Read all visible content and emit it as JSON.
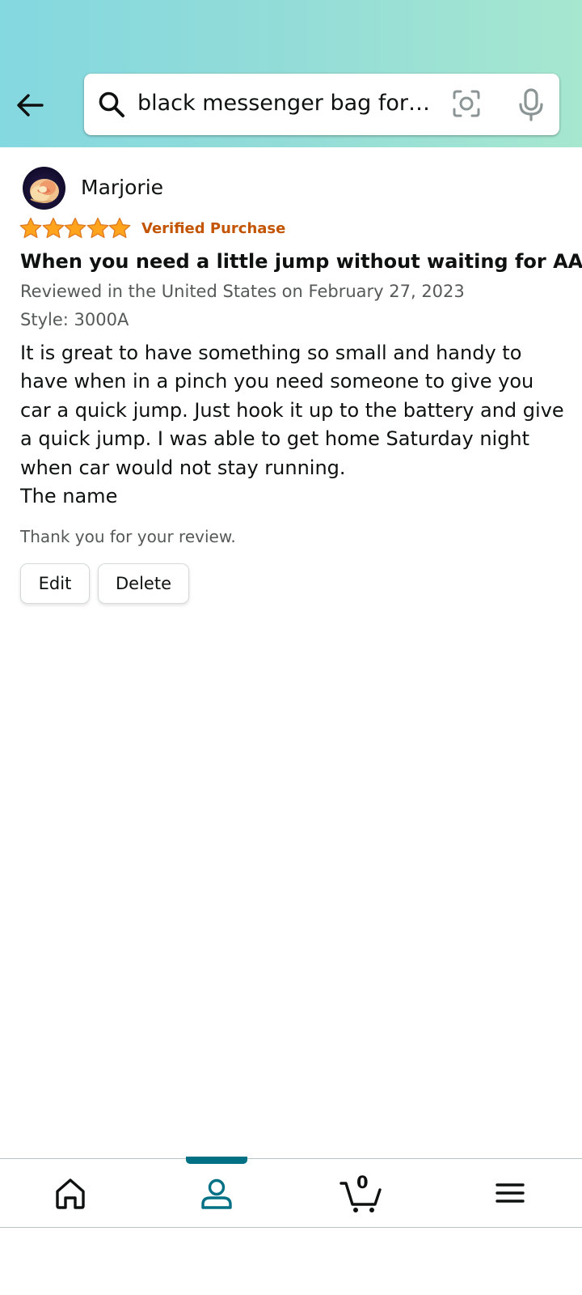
{
  "search": {
    "query": "black messenger bag for men"
  },
  "review": {
    "reviewer_name": "Marjorie",
    "rating": 5,
    "rating_max": 5,
    "verified_label": "Verified Purchase",
    "title": "When you need a little jump without waiting for AAA.",
    "meta": "Reviewed in the United States on February 27, 2023",
    "style": "Style: 3000A",
    "body_paragraphs": [
      "It is great to have something so small and handy to have when in a pinch you need someone to give you car a quick jump. Just hook it up to the battery and give a quick jump. I was able to get home Saturday night when car would not stay running.",
      "The name"
    ],
    "thanks": "Thank you for your review.",
    "edit_label": "Edit",
    "delete_label": "Delete"
  },
  "bottom_nav": {
    "cart_count": "0",
    "items": [
      {
        "icon": "home-icon",
        "active": false
      },
      {
        "icon": "account-icon",
        "active": true
      },
      {
        "icon": "cart-icon",
        "active": false
      },
      {
        "icon": "menu-icon",
        "active": false
      }
    ]
  },
  "colors": {
    "header_gradient_start": "#84d8e0",
    "header_gradient_end": "#a6e7cf",
    "star": "#ffa41c",
    "verified": "#c45500",
    "active_nav": "#007185"
  }
}
